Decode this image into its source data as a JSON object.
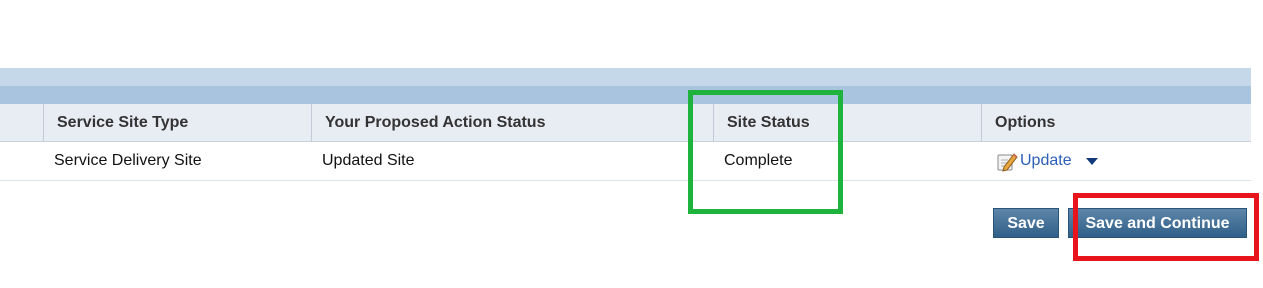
{
  "table": {
    "columns": [
      {
        "label": ""
      },
      {
        "label": "Service Site Type"
      },
      {
        "label": "Your Proposed Action Status"
      },
      {
        "label": "Site Status"
      },
      {
        "label": "Options"
      }
    ],
    "rows": [
      {
        "service_site_type": "Service Delivery Site",
        "proposed_action_status": "Updated Site",
        "site_status": "Complete",
        "options": {
          "update_label": "Update",
          "update_icon": "edit-pencil-icon",
          "menu_icon": "dropdown-caret-icon"
        }
      }
    ]
  },
  "actions": {
    "save_label": "Save",
    "save_continue_label": "Save and Continue"
  },
  "annotations": {
    "green_box_color": "#1eb33d",
    "red_box_color": "#e8141b"
  },
  "colors": {
    "header_band_light": "#c5d8ea",
    "header_band_dark": "#a8c4de",
    "column_header_bg": "#e8edf4",
    "link": "#2b5fb8",
    "button": "#3b6a93"
  }
}
